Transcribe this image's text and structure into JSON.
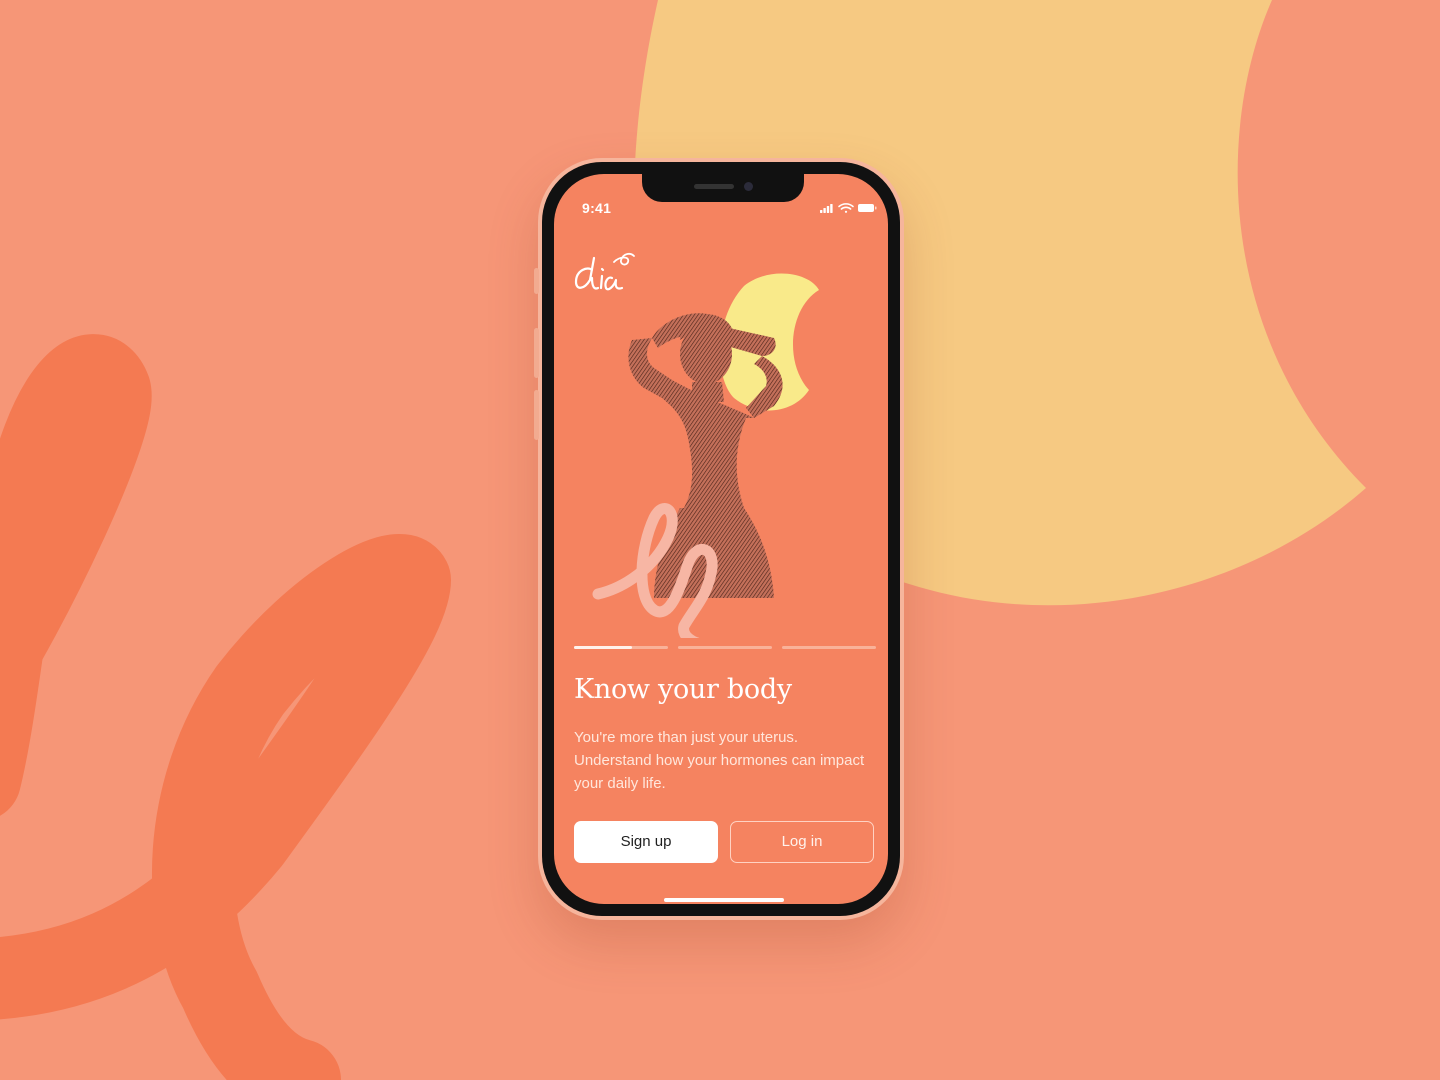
{
  "colors": {
    "background": "#f69677",
    "sun": "#f6c982",
    "scribble": "#f47a52",
    "screen": "#f58360",
    "hero_sun": "#f9ea8a",
    "button_primary_bg": "#ffffff"
  },
  "status_bar": {
    "time": "9:41",
    "icons": [
      "signal-icon",
      "wifi-icon",
      "battery-icon"
    ]
  },
  "app": {
    "logo_text": "dia"
  },
  "onboarding": {
    "step": 1,
    "total_steps": 3,
    "current_step_progress": 0.62,
    "title": "Know your body",
    "description": "You're more than just your uterus. Understand how your hormones can impact your daily life."
  },
  "actions": {
    "signup_label": "Sign up",
    "login_label": "Log in"
  }
}
